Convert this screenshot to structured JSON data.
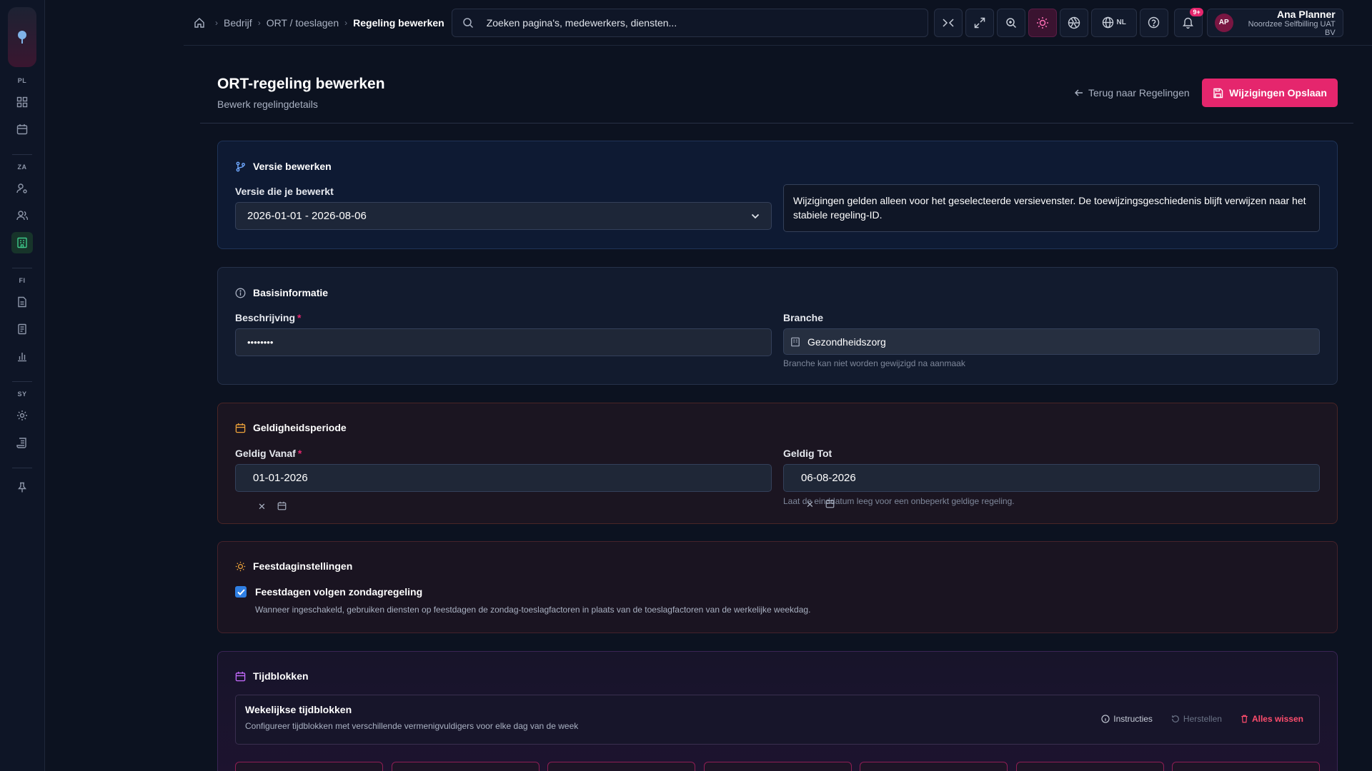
{
  "sidebar": {
    "sections": [
      {
        "code": "PL",
        "items": [
          "grid-icon",
          "calendar-icon"
        ]
      },
      {
        "code": "ZA",
        "items": [
          "user-settings-icon",
          "users-icon",
          "building-icon"
        ]
      },
      {
        "code": "FI",
        "items": [
          "document-icon",
          "receipt-icon",
          "bar-chart-icon"
        ]
      },
      {
        "code": "SY",
        "items": [
          "gear-icon",
          "scroll-icon"
        ]
      }
    ],
    "active_item": "building-icon",
    "accent_color": "#3ec98a"
  },
  "topbar": {
    "breadcrumbs": [
      "Bedrijf",
      "ORT / toeslagen",
      "Regeling bewerken"
    ],
    "search_placeholder": "Zoeken pagina's, medewerkers, diensten...",
    "language": "NL",
    "notification_badge": "9+",
    "user": {
      "initials": "AP",
      "name": "Ana Planner",
      "org": "Noordzee Selfbilling UAT BV"
    }
  },
  "page": {
    "title": "ORT-regeling bewerken",
    "subtitle": "Bewerk regelingdetails",
    "back_label": "Terug naar Regelingen",
    "save_label": "Wijzigingen Opslaan",
    "accent_color": "#e5266d"
  },
  "version": {
    "heading": "Versie bewerken",
    "label": "Versie die je bewerkt",
    "selected": "2026-01-01 - 2026-08-06",
    "info": "Wijzigingen gelden alleen voor het geselecteerde versievenster. De toewijzingsgeschiedenis blijft verwijzen naar het stabiele regeling-ID."
  },
  "basic": {
    "heading": "Basisinformatie",
    "description_label": "Beschrijving",
    "description_value": "••••••••",
    "branch_label": "Branche",
    "branch_value": "Gezondheidszorg",
    "branch_help": "Branche kan niet worden gewijzigd na aanmaak"
  },
  "validity": {
    "heading": "Geldigheidsperiode",
    "from_label": "Geldig Vanaf",
    "from_value": "01-01-2026",
    "to_label": "Geldig Tot",
    "to_value": "06-08-2026",
    "to_help": "Laat de einddatum leeg voor een onbeperkt geldige regeling."
  },
  "holidays": {
    "heading": "Feestdaginstellingen",
    "checkbox_label": "Feestdagen volgen zondagregeling",
    "checked": true,
    "help": "Wanneer ingeschakeld, gebruiken diensten op feestdagen de zondag-toeslagfactoren in plaats van de toeslagfactoren van de werkelijke weekdag."
  },
  "timeblocks": {
    "heading": "Tijdblokken",
    "box_title": "Wekelijkse tijdblokken",
    "box_sub": "Configureer tijdblokken met verschillende vermenigvuldigers voor elke dag van de week",
    "instructions_label": "Instructies",
    "reset_label": "Herstellen",
    "clear_label": "Alles wissen"
  }
}
